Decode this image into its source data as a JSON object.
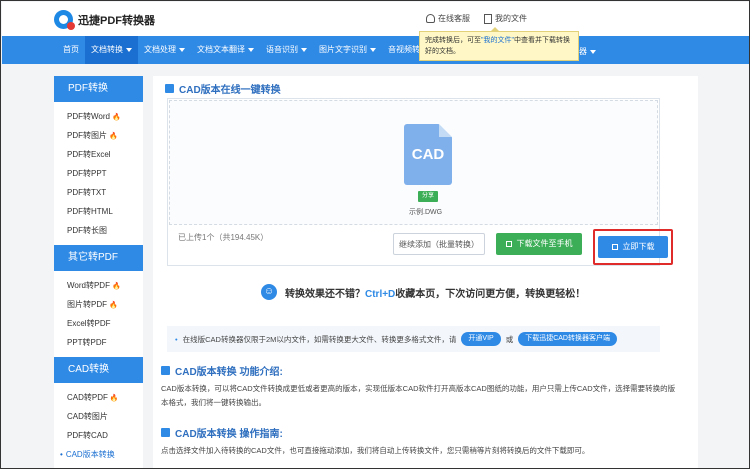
{
  "app": {
    "title": "迅捷PDF转换器",
    "top_links": [
      "在线客服",
      "我的文件"
    ]
  },
  "nav": {
    "items": [
      "首页",
      "文档转换",
      "文档处理",
      "文档文本翻译",
      "语音识别",
      "图片文字识别",
      "音视频转换"
    ],
    "active_index": 1,
    "tail_label": "器",
    "tooltip": {
      "before": "完成转换后，可至",
      "link": "\"我的文件\"",
      "after": "中查看并下载转换好的文档。"
    }
  },
  "sidebar": {
    "groups": [
      {
        "title": "PDF转换",
        "items": [
          {
            "label": "PDF转Word",
            "hot": true
          },
          {
            "label": "PDF转图片",
            "hot": true
          },
          {
            "label": "PDF转Excel",
            "hot": false
          },
          {
            "label": "PDF转PPT",
            "hot": false
          },
          {
            "label": "PDF转TXT",
            "hot": false
          },
          {
            "label": "PDF转HTML",
            "hot": false
          },
          {
            "label": "PDF转长图",
            "hot": false
          }
        ]
      },
      {
        "title": "其它转PDF",
        "items": [
          {
            "label": "Word转PDF",
            "hot": true
          },
          {
            "label": "图片转PDF",
            "hot": true
          },
          {
            "label": "Excel转PDF",
            "hot": false
          },
          {
            "label": "PPT转PDF",
            "hot": false
          }
        ]
      },
      {
        "title": "CAD转换",
        "items": [
          {
            "label": "CAD转PDF",
            "hot": true
          },
          {
            "label": "CAD转图片",
            "hot": false
          },
          {
            "label": "PDF转CAD",
            "hot": false
          },
          {
            "label": "CAD版本转换",
            "hot": false,
            "active": true
          }
        ]
      }
    ]
  },
  "main": {
    "section_title": "CAD版本在线一键转换",
    "file": {
      "icon_text": "CAD",
      "share_label": "分享",
      "name": "示例.DWG"
    },
    "upload_status": "已上传1个（共194.45K）",
    "buttons": {
      "continue": "继续添加（批量转换）",
      "phone": "下载文件至手机",
      "download": "立即下载"
    },
    "tip": {
      "prefix": "转换效果还不错？",
      "key": "Ctrl+D",
      "suffix": "收藏本页，下次访问更方便，转换更轻松！"
    },
    "notice": {
      "text": "在线版CAD转换器仅限于2M以内文件，如需转换更大文件、转换更多格式文件，请",
      "vip": "开通VIP",
      "or": "或",
      "client": "下载迅捷CAD转换器客户端"
    },
    "intro": {
      "title": "CAD版本转换 功能介绍:",
      "text": "CAD版本转换，可以将CAD文件转换成更低或者更高的版本，实现低版本CAD软件打开高版本CAD图纸的功能，用户只需上传CAD文件，选择需要转换的版本格式，我们将一键转换输出。"
    },
    "guide": {
      "title": "CAD版本转换 操作指南:",
      "text": "点击选择文件加入待转换的CAD文件，也可直接拖动添加，我们将自动上传转换文件，您只需稍等片刻将转换后的文件下载即可。"
    }
  },
  "colors": {
    "primary": "#2f8ae6",
    "green": "#3cae57",
    "highlight_border": "#e02b2b",
    "hot": "#f26b1d"
  }
}
